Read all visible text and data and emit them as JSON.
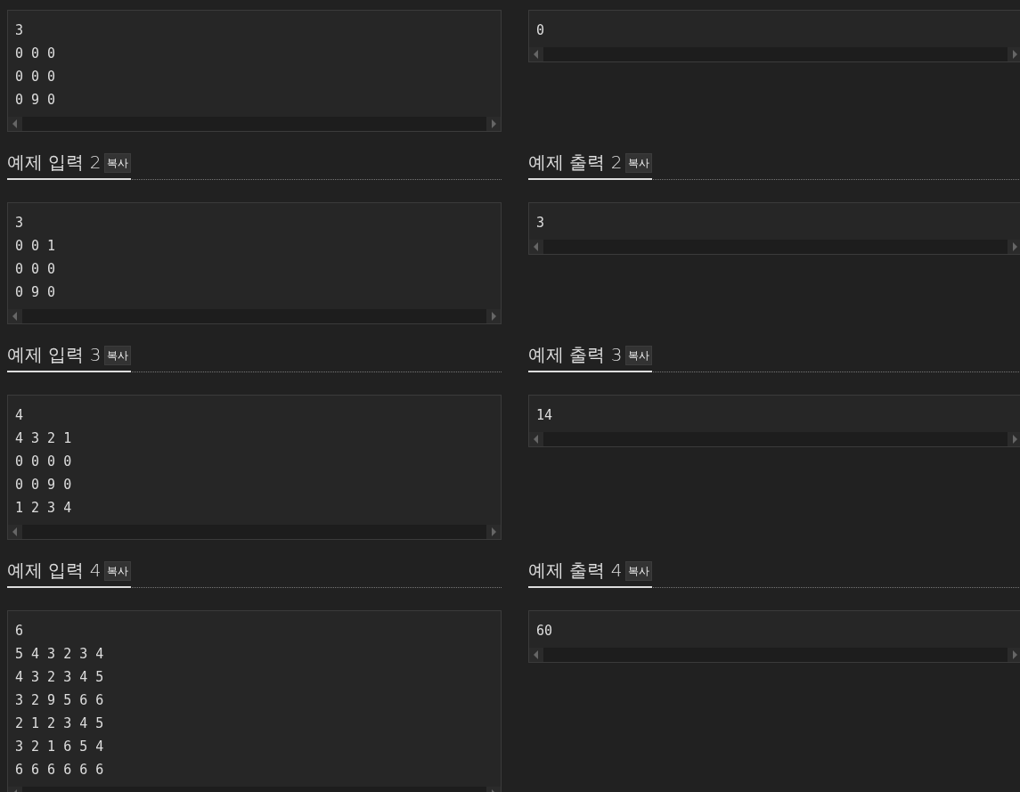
{
  "examples": [
    {
      "input": {
        "lines": [
          "3",
          "0 0 0",
          "0 0 0",
          "0 9 0"
        ]
      },
      "output": {
        "lines": [
          "0"
        ]
      }
    },
    {
      "input": {
        "heading": "예제 입력 2",
        "copy_label": "복사",
        "lines": [
          "3",
          "0 0 1",
          "0 0 0",
          "0 9 0"
        ]
      },
      "output": {
        "heading": "예제 출력 2",
        "copy_label": "복사",
        "lines": [
          "3"
        ]
      }
    },
    {
      "input": {
        "heading": "예제 입력 3",
        "copy_label": "복사",
        "lines": [
          "4",
          "4 3 2 1",
          "0 0 0 0",
          "0 0 9 0",
          "1 2 3 4"
        ]
      },
      "output": {
        "heading": "예제 출력 3",
        "copy_label": "복사",
        "lines": [
          "14"
        ]
      }
    },
    {
      "input": {
        "heading": "예제 입력 4",
        "copy_label": "복사",
        "lines": [
          "6",
          "5 4 3 2 3 4",
          "4 3 2 3 4 5",
          "3 2 9 5 6 6",
          "2 1 2 3 4 5",
          "3 2 1 6 5 4",
          "6 6 6 6 6 6"
        ]
      },
      "output": {
        "heading": "예제 출력 4",
        "copy_label": "복사",
        "lines": [
          "60"
        ]
      }
    }
  ]
}
